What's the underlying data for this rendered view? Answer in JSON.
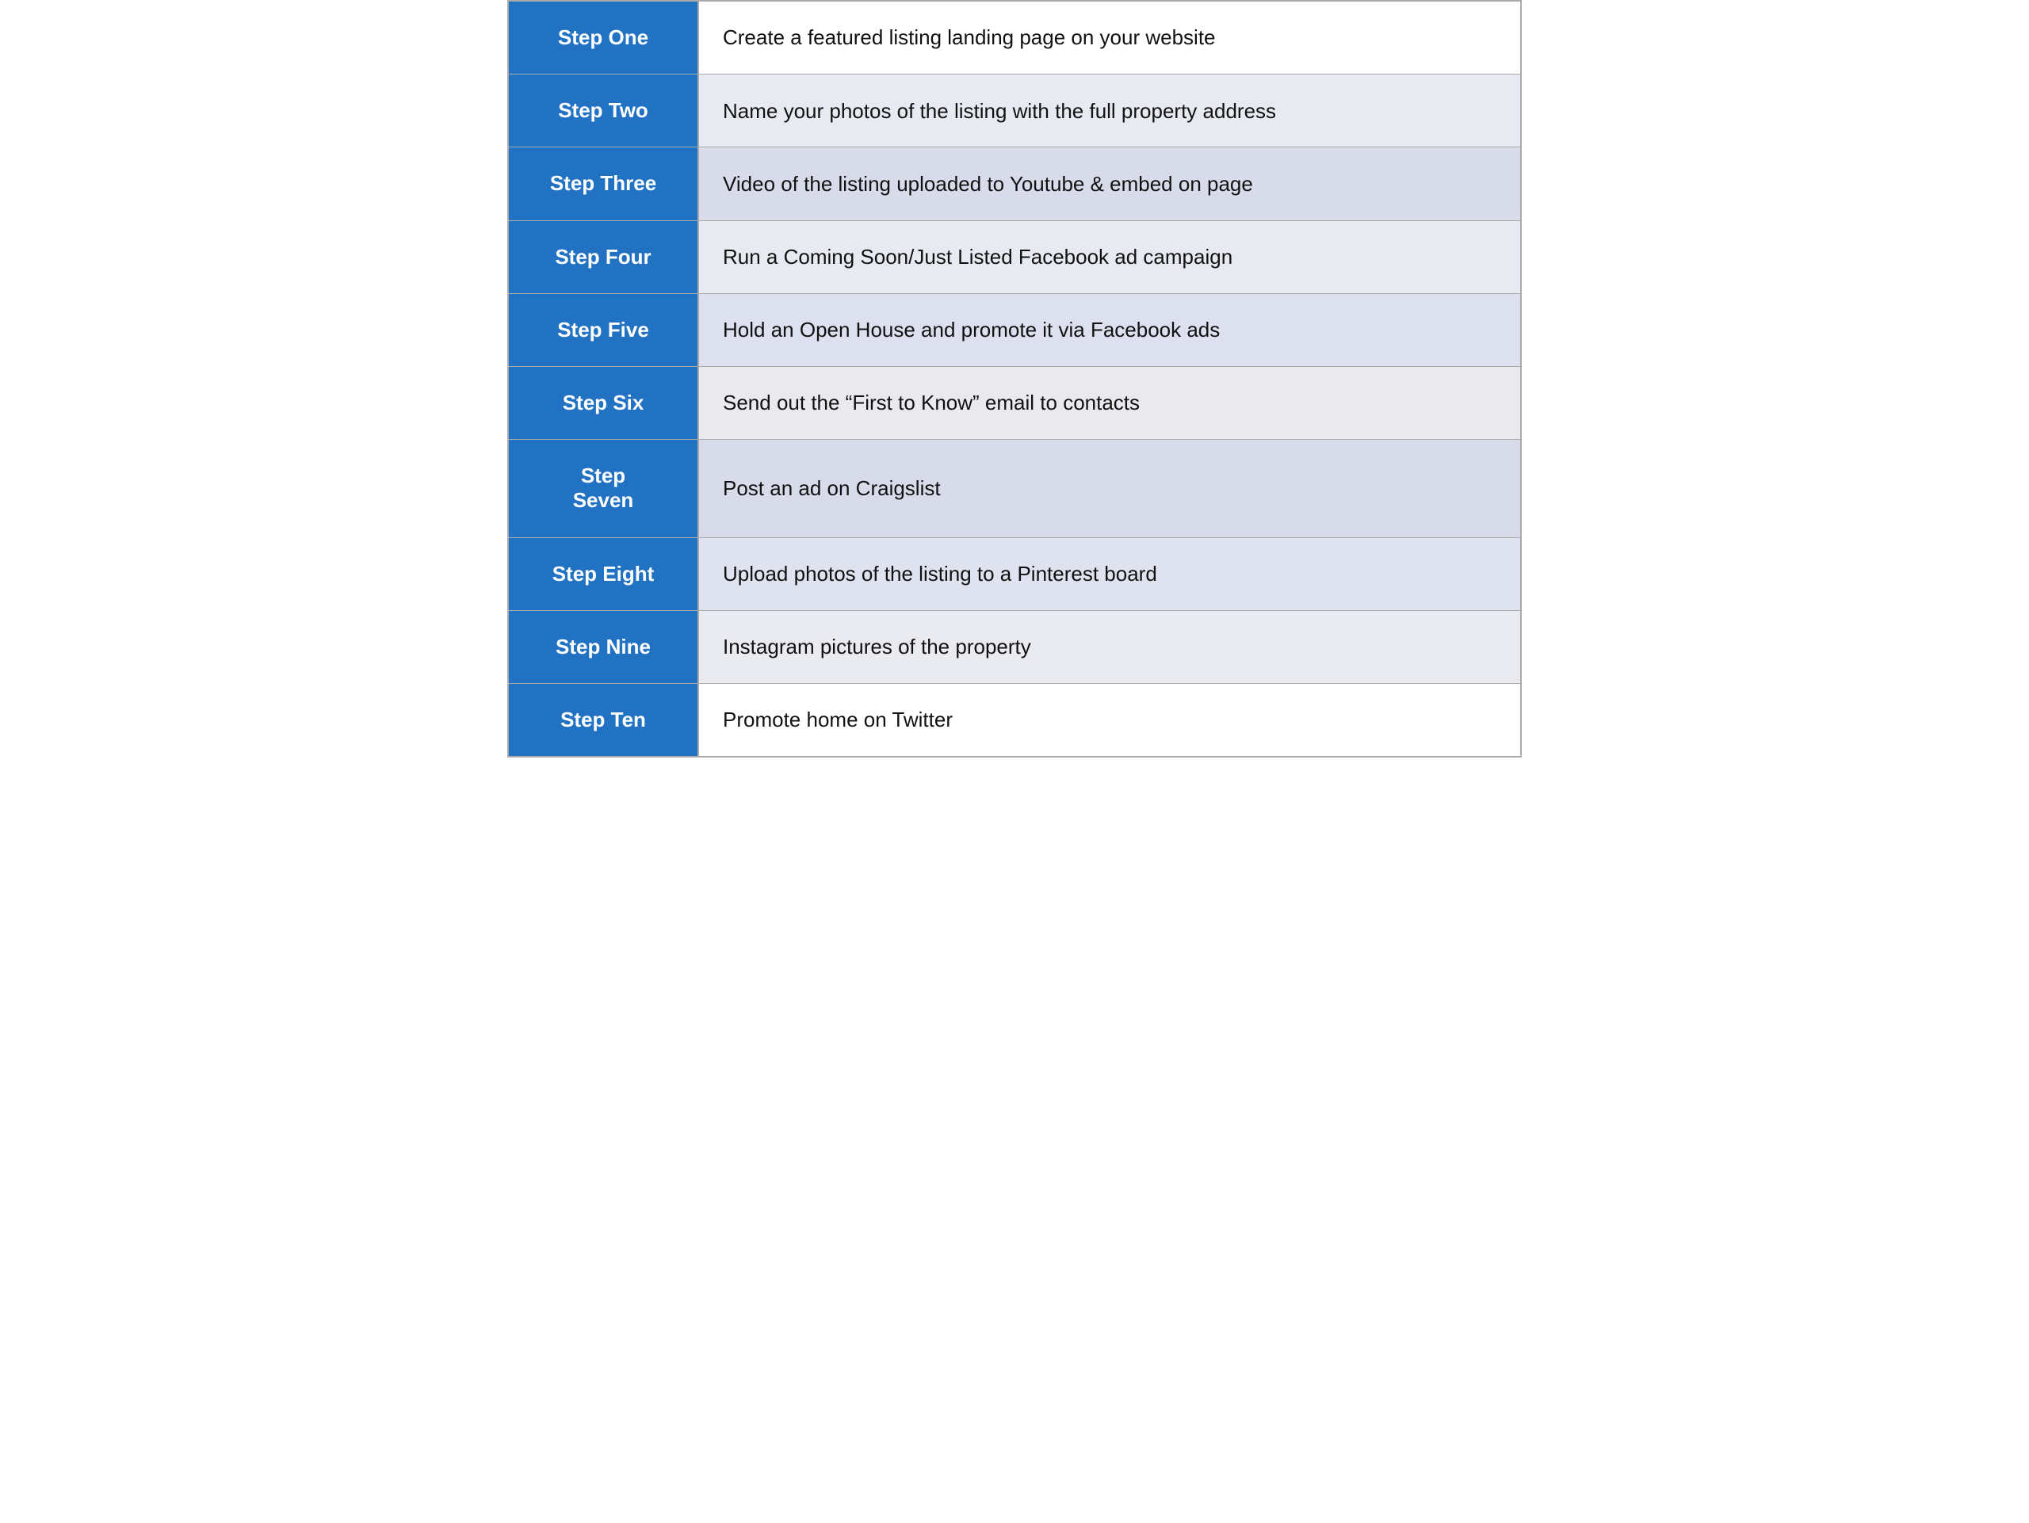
{
  "steps": [
    {
      "label": "Step One",
      "content": "Create a featured listing landing page on your website"
    },
    {
      "label": "Step Two",
      "content": "Name your photos of the listing with the full property address"
    },
    {
      "label": "Step Three",
      "content": "Video of the listing uploaded to Youtube & embed on page"
    },
    {
      "label": "Step Four",
      "content": "Run a Coming Soon/Just Listed Facebook ad campaign"
    },
    {
      "label": "Step Five",
      "content": "Hold an Open House and promote it via Facebook ads"
    },
    {
      "label": "Step Six",
      "content": "Send out the “First to Know” email to contacts"
    },
    {
      "label": "Step\nSeven",
      "content": "Post an ad on Craigslist"
    },
    {
      "label": "Step Eight",
      "content": "Upload photos of the listing to a Pinterest board"
    },
    {
      "label": "Step Nine",
      "content": "Instagram pictures of the property"
    },
    {
      "label": "Step Ten",
      "content": "Promote home on Twitter"
    }
  ]
}
